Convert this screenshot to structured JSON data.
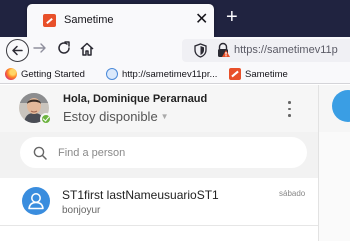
{
  "browser": {
    "tab": {
      "title": "Sametime",
      "favicon": "sametime-icon",
      "close_glyph": "✕"
    },
    "new_tab_glyph": "+",
    "nav": {
      "back": "arrow-left-icon",
      "forward": "arrow-right-icon",
      "reload": "reload-icon",
      "home": "home-icon"
    },
    "url": "https://sametimev11p",
    "bookmarks": [
      {
        "label": "Getting Started",
        "icon": "firefox-icon"
      },
      {
        "label": "http://sametimev11pr...",
        "icon": "globe-icon"
      },
      {
        "label": "Sametime",
        "icon": "sametime-icon"
      }
    ]
  },
  "app": {
    "user": {
      "greeting": "Hola, Dominique Perarnaud",
      "status": "Estoy disponible",
      "status_color": "#6cb33f"
    },
    "search": {
      "placeholder": "Find a person"
    },
    "chats": [
      {
        "name": "ST1first lastNameusuarioST1",
        "last_message": "bonjoyur",
        "time": "sábado",
        "avatar_color": "#3a8dde"
      }
    ],
    "accent_color": "#3a9ee4"
  }
}
